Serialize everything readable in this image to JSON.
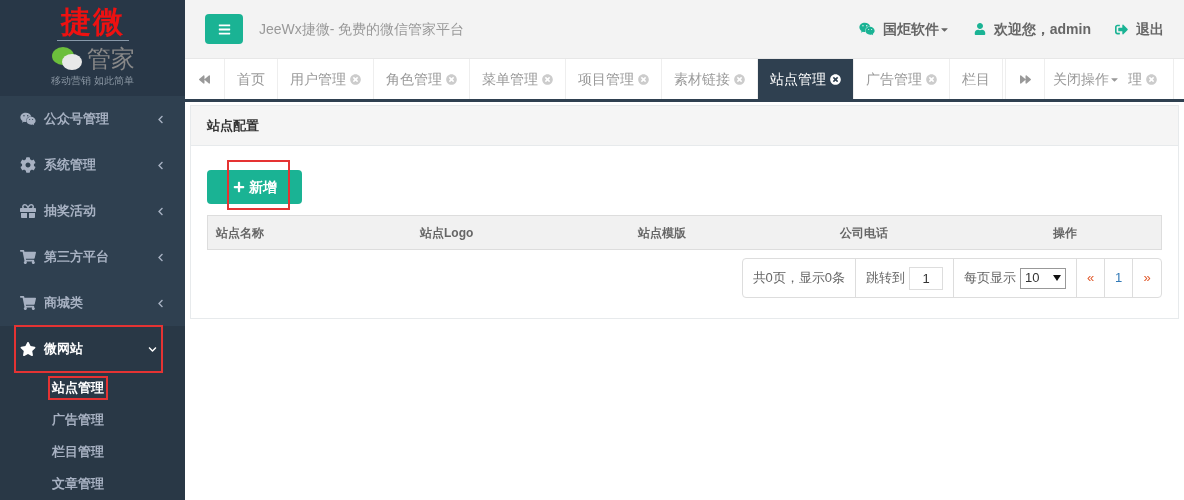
{
  "logo": {
    "title": "捷微",
    "subtitle": "管家",
    "slogan": "移动营销 如此简单"
  },
  "sidebar": {
    "items": [
      {
        "label": "公众号管理",
        "kind": "wechat",
        "expanded": false,
        "highlighted": false
      },
      {
        "label": "系统管理",
        "kind": "gear",
        "expanded": false,
        "highlighted": false
      },
      {
        "label": "抽奖活动",
        "kind": "gift",
        "expanded": false,
        "highlighted": false
      },
      {
        "label": "第三方平台",
        "kind": "cart",
        "expanded": false,
        "highlighted": false
      },
      {
        "label": "商城类",
        "kind": "cart",
        "expanded": false,
        "highlighted": false
      },
      {
        "label": "微网站",
        "kind": "star",
        "expanded": true,
        "highlighted": true,
        "children": [
          {
            "label": "站点管理",
            "selected": true,
            "highlighted": true
          },
          {
            "label": "广告管理",
            "selected": false,
            "highlighted": false
          },
          {
            "label": "栏目管理",
            "selected": false,
            "highlighted": false
          },
          {
            "label": "文章管理",
            "selected": false,
            "highlighted": false
          }
        ]
      }
    ]
  },
  "header": {
    "title": "JeeWx捷微- 免费的微信管家平台",
    "account": "国炬软件",
    "welcome": "欢迎您，admin",
    "logout": "退出"
  },
  "tabs": [
    {
      "label": "首页",
      "selected": false,
      "closable": false
    },
    {
      "label": "用户管理",
      "selected": false,
      "closable": true
    },
    {
      "label": "角色管理",
      "selected": false,
      "closable": true
    },
    {
      "label": "菜单管理",
      "selected": false,
      "closable": true
    },
    {
      "label": "项目管理",
      "selected": false,
      "closable": true
    },
    {
      "label": "素材链接",
      "selected": false,
      "closable": true
    },
    {
      "label": "站点管理",
      "selected": true,
      "closable": true
    },
    {
      "label": "广告管理",
      "selected": false,
      "closable": true
    },
    {
      "label": "栏目",
      "selected": false,
      "closable": false
    }
  ],
  "tab_tools": {
    "close_menu": "关闭操作",
    "hidden_tab_tail": "理"
  },
  "panel": {
    "title": "站点配置",
    "add_button": {
      "label": "新增",
      "highlighted": true
    },
    "table": {
      "columns": [
        "站点名称",
        "站点Logo",
        "站点模版",
        "公司电话",
        "操作"
      ]
    },
    "pagination": {
      "summary": "共0页，显示0条",
      "jump_label": "跳转到",
      "jump_value": "1",
      "page_size_label": "每页显示",
      "page_size": "10",
      "prev": "«",
      "pages": [
        "1"
      ],
      "next": "»"
    }
  }
}
